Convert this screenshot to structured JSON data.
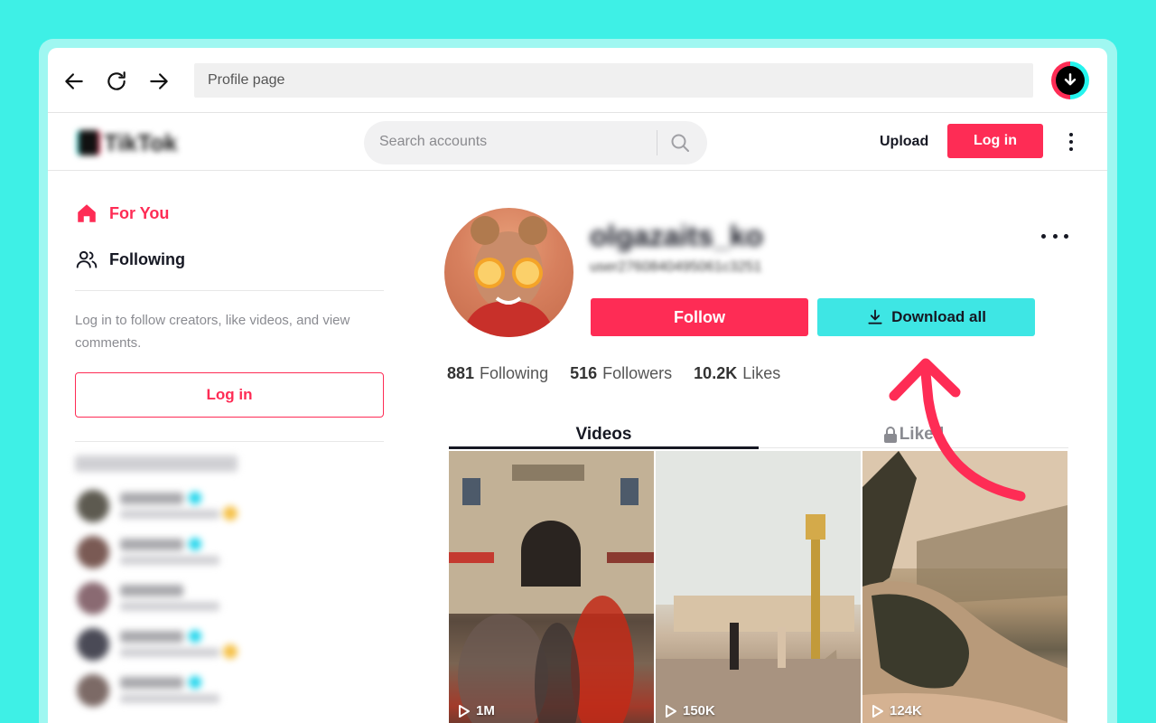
{
  "browser": {
    "address": "Profile page"
  },
  "header": {
    "logo_text": "TikTok",
    "search_placeholder": "Search accounts",
    "upload_label": "Upload",
    "login_label": "Log in"
  },
  "sidebar": {
    "items": [
      {
        "label": "For You",
        "icon": "home-icon"
      },
      {
        "label": "Following",
        "icon": "people-icon"
      }
    ],
    "hint": "Log in to follow creators, like videos, and view comments.",
    "login_label": "Log in"
  },
  "profile": {
    "username": "olgazaits_ko",
    "handle": "user2760840495061c3251",
    "follow_label": "Follow",
    "download_label": "Download all",
    "stats": [
      {
        "num": "881",
        "label": "Following"
      },
      {
        "num": "516",
        "label": "Followers"
      },
      {
        "num": "10.2K",
        "label": "Likes"
      }
    ]
  },
  "tabs": [
    {
      "label": "Videos"
    },
    {
      "label": "Liked"
    }
  ],
  "videos": [
    {
      "views": "1M"
    },
    {
      "views": "150K"
    },
    {
      "views": "124K"
    }
  ],
  "colors": {
    "brand": "#fe2c55",
    "accent": "#3ee6e4",
    "background": "#3ef0e6"
  }
}
